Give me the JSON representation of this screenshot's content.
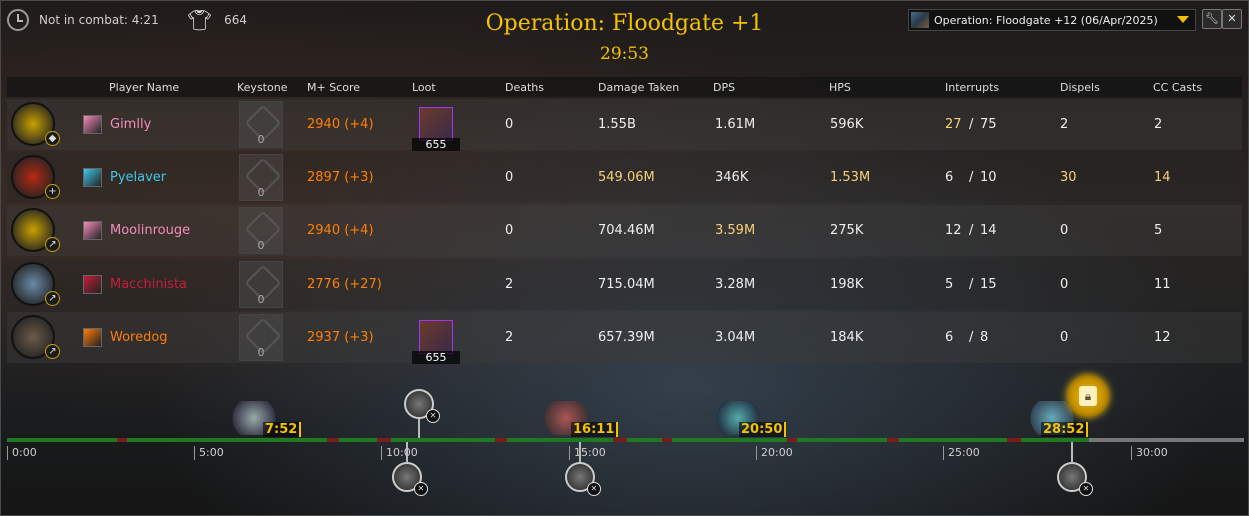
{
  "top": {
    "combat_status": "Not in combat: 4:21",
    "item_level": "664"
  },
  "title": "Operation: Floodgate +1",
  "timer": "29:53",
  "run_selector": {
    "value": "Operation: Floodgate +12 (06/Apr/2025)"
  },
  "columns": {
    "player_name": "Player Name",
    "keystone": "Keystone",
    "score": "M+ Score",
    "loot": "Loot",
    "deaths": "Deaths",
    "damage_taken": "Damage Taken",
    "dps": "DPS",
    "hps": "HPS",
    "interrupts": "Interrupts",
    "dispels": "Dispels",
    "cc": "CC Casts"
  },
  "players": [
    {
      "name": "Gimlly",
      "name_color": "#f48cba",
      "keystone": "0",
      "score": "2940 (+4)",
      "loot": "655",
      "deaths": "0",
      "damage_taken": "1.55B",
      "dps": "1.61M",
      "hps": "596K",
      "interrupts": "27",
      "interrupts_total": "75",
      "dispels": "2",
      "cc": "2",
      "role": "tank",
      "spec_color": "#c9a100"
    },
    {
      "name": "Pyelaver",
      "name_color": "#3fc7eb",
      "keystone": "0",
      "score": "2897 (+3)",
      "loot": "",
      "deaths": "0",
      "damage_taken": "549.06M",
      "dps": "346K",
      "hps": "1.53M",
      "interrupts": "6",
      "interrupts_total": "10",
      "dispels": "30",
      "cc": "14",
      "role": "healer",
      "spec_color": "#b52a12"
    },
    {
      "name": "Moolinrouge",
      "name_color": "#f48cba",
      "keystone": "0",
      "score": "2940 (+4)",
      "loot": "",
      "deaths": "0",
      "damage_taken": "704.46M",
      "dps": "3.59M",
      "hps": "275K",
      "interrupts": "12",
      "interrupts_total": "14",
      "dispels": "0",
      "cc": "5",
      "role": "dps",
      "spec_color": "#c9a100"
    },
    {
      "name": "Macchinista",
      "name_color": "#c41e3a",
      "keystone": "0",
      "score": "2776 (+27)",
      "loot": "",
      "deaths": "2",
      "damage_taken": "715.04M",
      "dps": "3.28M",
      "hps": "198K",
      "interrupts": "5",
      "interrupts_total": "15",
      "dispels": "0",
      "cc": "11",
      "role": "dps",
      "spec_color": "#6a8aa8"
    },
    {
      "name": "Woredog",
      "name_color": "#ff7c0a",
      "keystone": "0",
      "score": "2937 (+3)",
      "loot": "655",
      "deaths": "2",
      "damage_taken": "657.39M",
      "dps": "3.04M",
      "hps": "184K",
      "interrupts": "6",
      "interrupts_total": "8",
      "dispels": "0",
      "cc": "12",
      "role": "dps",
      "spec_color": "#6b5a4a"
    }
  ],
  "timeline": {
    "ticks": [
      "0:00",
      "5:00",
      "10:00",
      "15:00",
      "20:00",
      "25:00",
      "30:00"
    ],
    "boss_kills": [
      "7:52",
      "16:11",
      "20:50",
      "28:52"
    ]
  },
  "colors": {
    "gold": "#f3c200",
    "score": "#ff8000",
    "highlight": "#f5d07a"
  },
  "icons": {
    "clock": "clock-icon",
    "shirt": "shirt-icon",
    "settings": "wrench-icon",
    "close": "close-icon",
    "chest": "vault-icon"
  }
}
